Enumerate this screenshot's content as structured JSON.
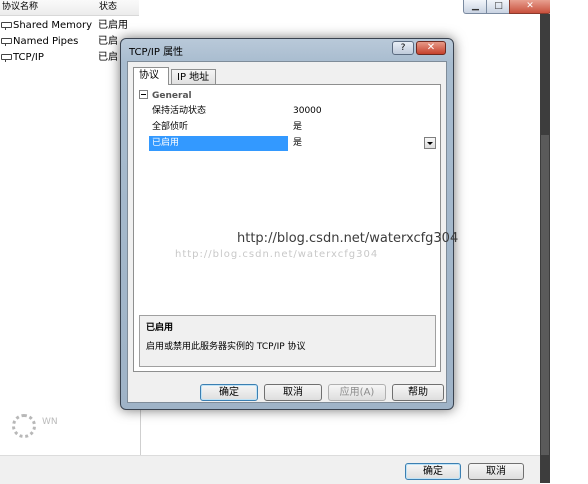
{
  "background": {
    "columns": {
      "name": "协议名称",
      "status": "状态"
    },
    "protocols": [
      {
        "name": "Shared Memory",
        "status": "已启用"
      },
      {
        "name": "Named Pipes",
        "status": "已启"
      },
      {
        "name": "TCP/IP",
        "status": "已启"
      }
    ],
    "title_buttons": {
      "minimize": "▁",
      "maximize": "□",
      "close": "✕"
    },
    "buttons": {
      "ok": "确定",
      "cancel": "取消"
    },
    "faint_text": "WN"
  },
  "dialog": {
    "title": "TCP/IP 属性",
    "help_glyph": "?",
    "close_glyph": "✕",
    "tabs": [
      {
        "label": "协议",
        "active": true
      },
      {
        "label": "IP 地址",
        "active": false
      }
    ],
    "category": {
      "expander": "⊟",
      "name": "General"
    },
    "properties": [
      {
        "name": "保持活动状态",
        "value": "30000"
      },
      {
        "name": "全部侦听",
        "value": "是"
      },
      {
        "name": "已启用",
        "value": "是",
        "selected": true
      }
    ],
    "description": {
      "title": "已启用",
      "text": "启用或禁用此服务器实例的 TCP/IP 协议"
    },
    "buttons": {
      "ok": "确定",
      "cancel": "取消",
      "apply": "应用(A)",
      "help": "帮助"
    },
    "watermark_main": "http://blog.csdn.net/waterxcfg304",
    "watermark_ghost": "http://blog.csdn.net/waterxcfg304"
  },
  "colors": {
    "selection": "#3399ff",
    "dialog_frame": "#a8bccf",
    "close_button": "#c5412d"
  }
}
